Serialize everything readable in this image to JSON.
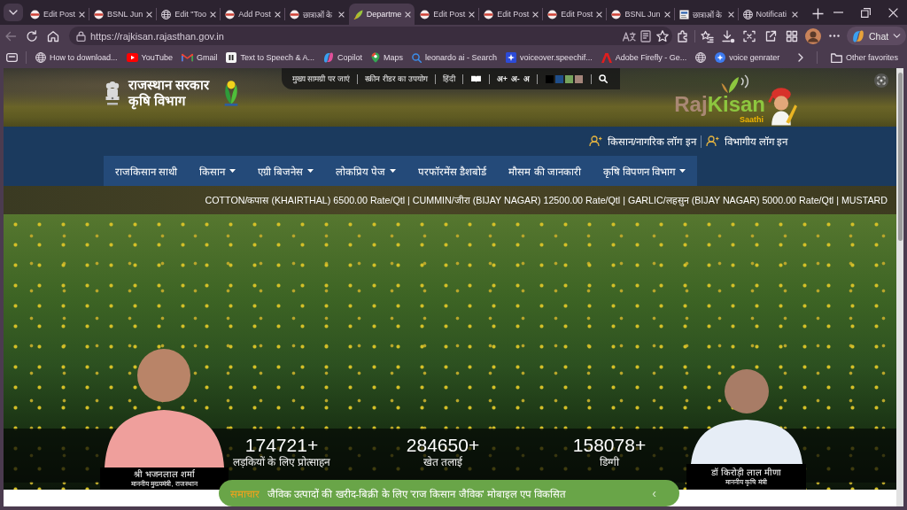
{
  "browser": {
    "tabs": [
      {
        "title": "Edit Post",
        "kind": "site",
        "selected": false
      },
      {
        "title": "BSNL Jun",
        "kind": "site",
        "selected": false
      },
      {
        "title": "Edit \"Too",
        "kind": "globe",
        "selected": false
      },
      {
        "title": "Add Post",
        "kind": "site",
        "selected": false
      },
      {
        "title": "छात्राओं के",
        "kind": "site",
        "selected": false
      },
      {
        "title": "Departme",
        "kind": "leaf",
        "selected": true
      },
      {
        "title": "Edit Post",
        "kind": "site",
        "selected": false
      },
      {
        "title": "Edit Post",
        "kind": "site",
        "selected": false
      },
      {
        "title": "Edit Post",
        "kind": "site",
        "selected": false
      },
      {
        "title": "BSNL Jun",
        "kind": "site",
        "selected": false
      },
      {
        "title": "छात्राओं के",
        "kind": "doc",
        "selected": false
      },
      {
        "title": "Notificati",
        "kind": "globe",
        "selected": false
      }
    ],
    "nav_buttons": [
      {
        "kind": "back",
        "disabled": true
      },
      {
        "kind": "reload",
        "disabled": false
      },
      {
        "kind": "home",
        "disabled": false
      }
    ],
    "url": "https://rajkisan.rajasthan.gov.in",
    "chat_label": "Chat",
    "bookmarks": [
      {
        "kind": "globe",
        "label": "How to download..."
      },
      {
        "kind": "play",
        "label": "YouTube"
      },
      {
        "kind": "mail",
        "label": "Gmail"
      },
      {
        "kind": "pause",
        "label": "Text to Speech & A..."
      },
      {
        "kind": "swirl",
        "label": "Copilot"
      },
      {
        "kind": "pin",
        "label": "Maps"
      },
      {
        "kind": "search",
        "label": "leonardo ai - Search"
      },
      {
        "kind": "spark",
        "label": "voiceover.speechif..."
      },
      {
        "kind": "triangle",
        "label": "Adobe Firefly - Ge..."
      },
      {
        "kind": "globe"
      },
      {
        "kind": "dot",
        "label": "voice genrater"
      }
    ],
    "other_favorites": "Other favorites"
  },
  "page": {
    "header": {
      "org": "राजस्थान सरकार",
      "department": "कृषि विभाग",
      "utility_links": [
        "मुख्य सामग्री पर जाएं",
        "स्क्रीन रीडर का उपयोग",
        "हिंदी"
      ],
      "font_size_controls": [
        "अ+",
        "अ-",
        "अ"
      ],
      "theme_swatches": [
        {
          "color": "#000000"
        },
        {
          "color": "#1f4e8a"
        },
        {
          "color": "#76a35c"
        },
        {
          "color": "#a4857a"
        }
      ],
      "logo": {
        "word_1": "Raj",
        "word_2": "Kisan",
        "tagline": "Saathi"
      }
    },
    "login_links": [
      "किसान/नागरिक लॉग इन",
      "विभागीय लॉग इन"
    ],
    "menu": [
      {
        "label": "राजकिसान साथी",
        "dropdown": false
      },
      {
        "label": "किसान",
        "dropdown": true
      },
      {
        "label": "एग्री बिजनेस",
        "dropdown": true
      },
      {
        "label": "लोकप्रिय पेज",
        "dropdown": true
      },
      {
        "label": "परफॉरमेंस डैशबोर्ड",
        "dropdown": false
      },
      {
        "label": "मौसम की जानकारी",
        "dropdown": false
      },
      {
        "label": "कृषि विपणन विभाग",
        "dropdown": true
      }
    ],
    "ticker": "COTTON/कपास (KHAIRTHAL) 6500.00 Rate/Qtl | CUMMIN/जीरा (BIJAY NAGAR) 12500.00 Rate/Qtl | GARLIC/लहसुन (BIJAY NAGAR) 5000.00 Rate/Qtl | MUSTARD",
    "stats": [
      {
        "value": "174721+",
        "label": "लड़कियों के लिए प्रोत्साहन"
      },
      {
        "value": "284650+",
        "label": "खेत तलाई"
      },
      {
        "value": "158078+",
        "label": "डिग्गी"
      }
    ],
    "leaders": [
      {
        "name": "श्री भजनलाल शर्मा",
        "title": "माननीय मुख्यमंत्री, राजस्थान"
      },
      {
        "name": "डॉ किरोड़ी लाल मीणा",
        "title": "माननीय कृषि मंत्री"
      }
    ],
    "news": {
      "label": "समाचार",
      "text": "जैविक उत्पादों की खरीद-बिक्री के लिए 'राज किसान जैविक' मोबाइल एप विकसित",
      "control": "‹"
    }
  }
}
